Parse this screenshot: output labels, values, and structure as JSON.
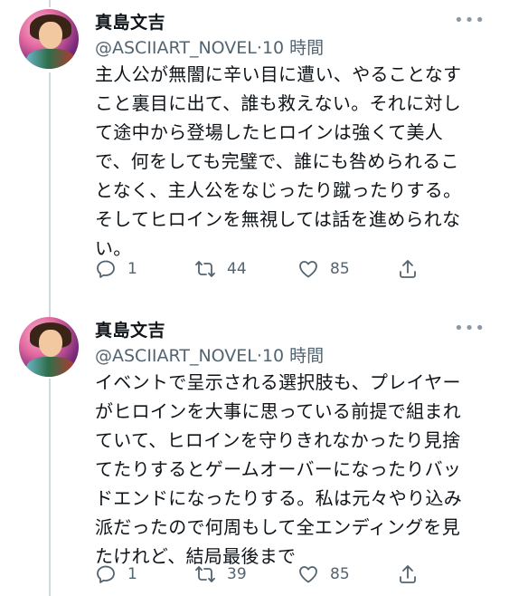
{
  "tweets": [
    {
      "author_name": "真島文吉",
      "handle": "@ASCIIART_NOVEL",
      "separator": "·",
      "time": "10 時間",
      "more_label": "•••",
      "text": "主人公が無闇に辛い目に遭い、やることなす\nこと裏目に出て、誰も救えない。それに対し\nて途中から登場したヒロインは強くて美人\nで、何をしても完璧で、誰にも咎められるこ\nとなく、主人公をなじったり蹴ったりする。\nそしてヒロインを無視しては話を進められな\nい。",
      "reply_count": "1",
      "retweet_count": "44",
      "like_count": "85"
    },
    {
      "author_name": "真島文吉",
      "handle": "@ASCIIART_NOVEL",
      "separator": "·",
      "time": "10 時間",
      "more_label": "•••",
      "text": "イベントで呈示される選択肢も、プレイヤー\nがヒロインを大事に思っている前提で組まれ\nていて、ヒロインを守りきれなかったり見捨\nてたりするとゲームオーバーになったりバッ\nドエンドになったりする。私は元々やり込み\n派だったので何周もして全エンディングを見\nたけれど、結局最後まで",
      "reply_count": "1",
      "retweet_count": "39",
      "like_count": "85"
    }
  ],
  "icons": {
    "reply": "reply-icon",
    "retweet": "retweet-icon",
    "like": "heart-icon",
    "share": "share-icon",
    "more": "more-icon"
  },
  "colors": {
    "text": "#0f1419",
    "secondary": "#536471",
    "thread_line": "#cfd9de"
  }
}
